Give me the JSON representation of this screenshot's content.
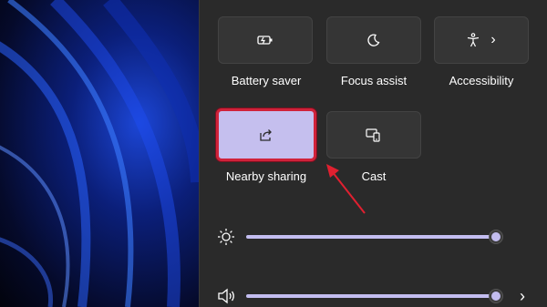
{
  "quick_settings": {
    "tiles": [
      {
        "label": "Battery saver",
        "icon": "battery-saver-icon"
      },
      {
        "label": "Focus assist",
        "icon": "moon-icon"
      },
      {
        "label": "Accessibility",
        "icon": "accessibility-icon",
        "chevron": "›"
      },
      {
        "label": "Nearby sharing",
        "icon": "share-icon",
        "state": "on"
      },
      {
        "label": "Cast",
        "icon": "cast-icon"
      }
    ],
    "brightness": {
      "icon": "sun-icon",
      "level": 1.0
    },
    "volume": {
      "icon": "speaker-icon",
      "level": 1.0,
      "chevron": "›"
    }
  },
  "colors": {
    "accent": "#c3bdf0",
    "highlight_border": "#d0223a",
    "annotation_arrow": "#e02030",
    "panel_bg": "#2a2a2a",
    "tile_bg": "#353535"
  }
}
